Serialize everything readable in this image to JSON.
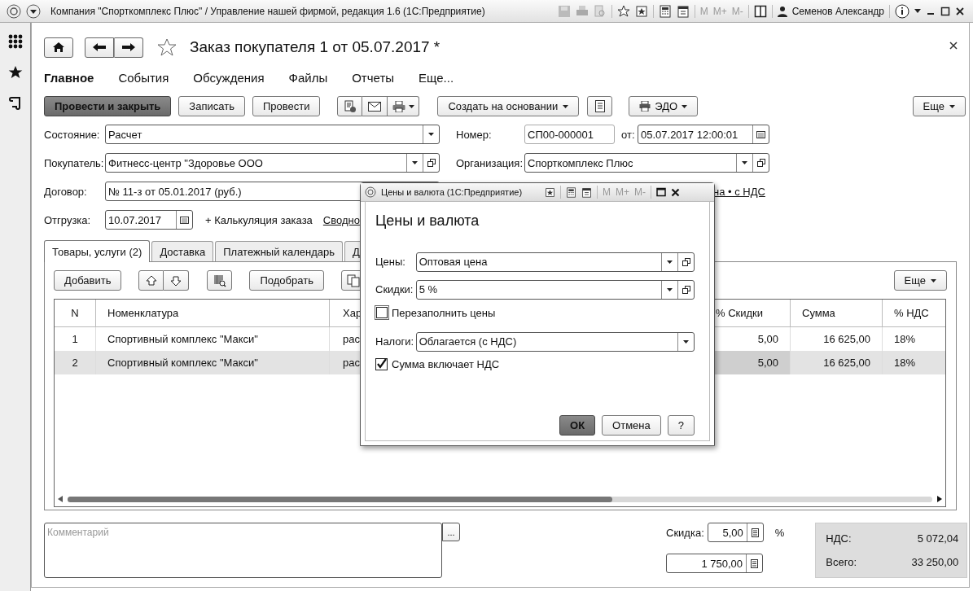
{
  "app": {
    "title": "Компания \"Спорткомплекс Плюс\" / Управление нашей фирмой, редакция 1.6  (1С:Предприятие)",
    "memory_buttons": [
      "M",
      "M+",
      "M-"
    ],
    "user": "Семенов Александр"
  },
  "form": {
    "title": "Заказ покупателя 1 от 05.07.2017 *",
    "sections": [
      {
        "label": "Главное",
        "selected": true
      },
      {
        "label": "События",
        "selected": false
      },
      {
        "label": "Обсуждения",
        "selected": false
      },
      {
        "label": "Файлы",
        "selected": false
      },
      {
        "label": "Отчеты",
        "selected": false
      },
      {
        "label": "Еще...",
        "selected": false
      }
    ],
    "commands": [
      {
        "label": "Провести и закрыть",
        "kind": "primary"
      },
      {
        "label": "Записать",
        "kind": "default"
      },
      {
        "label": "Провести",
        "kind": "default"
      }
    ],
    "create_based": "Создать на основании",
    "edo": "ЭДО",
    "more": "Еще",
    "status": {
      "label": "Состояние:",
      "value": "Расчет"
    },
    "number": {
      "label": "Номер:",
      "value": "СП00-000001"
    },
    "date": {
      "label": "от:",
      "value": "05.07.2017 12:00:01"
    },
    "customer": {
      "label": "Покупатель:",
      "value": "Фитнесс-центр \"Здоровье ООО"
    },
    "organization": {
      "label": "Организация:",
      "value": "Спорткомплекс Плюс"
    },
    "contract": {
      "label": "Договор:",
      "value": "№ 11-з от 05.01.2017 (руб.)"
    },
    "price_link": "на • с НДС",
    "shipment": {
      "label": "Отгрузка:",
      "value": "10.07.2017"
    },
    "calc_link": "+ Калькуляция заказа",
    "summary_link": "Сводно",
    "tabs": [
      {
        "label": "Товары, услуги (2)",
        "selected": true
      },
      {
        "label": "Доставка",
        "selected": false
      },
      {
        "label": "Платежный календарь",
        "selected": false
      },
      {
        "label": "Д",
        "selected": false
      }
    ],
    "table_toolbar": {
      "add": "Добавить",
      "pick": "Подобрать",
      "more": "Еще"
    },
    "table": {
      "columns": [
        "N",
        "Номенклатура",
        "Хар",
        "% Скидки",
        "Сумма",
        "% НДС"
      ],
      "rows": [
        {
          "cells": [
            "1",
            "Спортивный комплекс \"Макси\"",
            "рас",
            "5,00",
            "16 625,00",
            "18%"
          ],
          "selected": false
        },
        {
          "cells": [
            "2",
            "Спортивный комплекс \"Макси\"",
            "рас",
            "5,00",
            "16 625,00",
            "18%"
          ],
          "selected": true
        }
      ]
    },
    "comment": {
      "placeholder": "Комментарий",
      "button": "..."
    },
    "discount": {
      "label": "Скидка:",
      "value": "5,00",
      "unit": "%",
      "amount": "1 750,00"
    },
    "totals": [
      {
        "label": "НДС:",
        "value": "5 072,04"
      },
      {
        "label": "Всего:",
        "value": "33 250,00"
      }
    ]
  },
  "dialog": {
    "title": "Цены и валюта  (1С:Предприятие)",
    "memory_buttons": [
      "M",
      "M+",
      "M-"
    ],
    "heading": "Цены и валюта",
    "prices": {
      "label": "Цены:",
      "value": "Оптовая цена"
    },
    "discounts": {
      "label": "Скидки:",
      "value": "5 %"
    },
    "refill": {
      "label": "Перезаполнить цены",
      "checked": false
    },
    "taxes": {
      "label": "Налоги:",
      "value": "Облагается (с НДС)"
    },
    "includes_vat": {
      "label": "Сумма включает НДС",
      "checked": true
    },
    "buttons": [
      {
        "label": "ОК",
        "kind": "primary"
      },
      {
        "label": "Отмена",
        "kind": "default"
      },
      {
        "label": "?",
        "kind": "default"
      }
    ]
  }
}
